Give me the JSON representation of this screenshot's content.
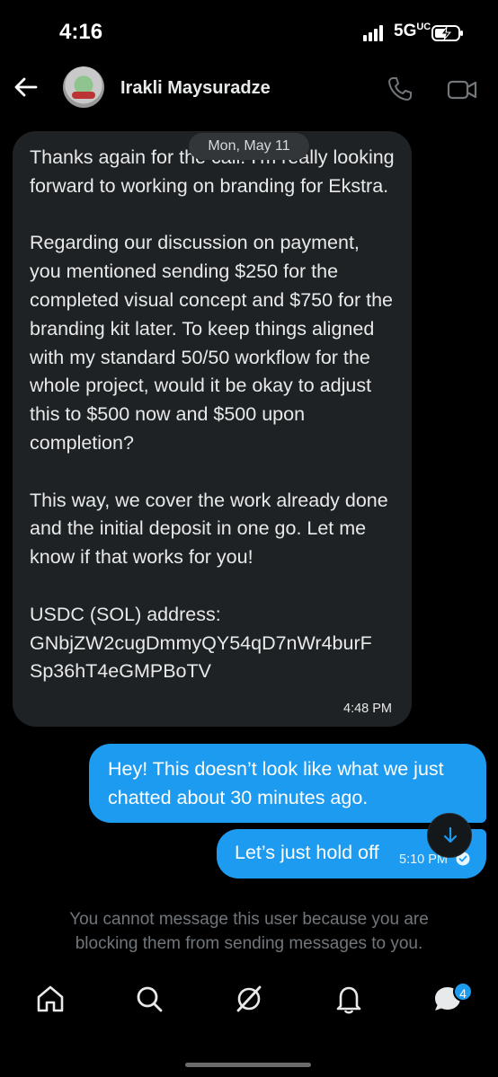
{
  "status_bar": {
    "time": "4:16",
    "network": "5G",
    "network_suffix": "UC"
  },
  "header": {
    "contact_name": "Irakli Maysuradze",
    "icons": [
      "back-arrow-icon",
      "avatar",
      "phone-icon",
      "video-icon"
    ]
  },
  "conversation": {
    "date_separator": "Mon, May 11",
    "received": {
      "text": "Thanks again for the call! I'm really looking forward to working on branding for Ekstra.\n\nRegarding our discussion on payment, you mentioned sending $250 for the completed visual concept and $750 for the branding kit later. To keep things aligned with my standard 50/50 workflow for the whole project, would it be okay to adjust this to $500 now and $500 upon completion?\n\nThis way, we cover the work already done and the initial deposit in one go. Let me know if that works for you!\n\nUSDC (SOL) address:\nGNbjZW2cugDmmyQY54qD7nWr4burF\nSp36hT4eGMPBoTV",
      "time": "4:48 PM"
    },
    "sent": [
      {
        "text": "Hey! This doesn’t look like what we just chatted about 30 minutes ago."
      },
      {
        "text": "Let’s just hold off",
        "time": "5:10 PM"
      }
    ],
    "blocked_notice": "You cannot message this user because you are blocking them from sending messages to you."
  },
  "bottom_nav": {
    "items": [
      "home-icon",
      "search-icon",
      "grok-icon",
      "notifications-icon",
      "messages-icon"
    ],
    "messages_badge": "4"
  },
  "colors": {
    "accent": "#1d9bf0",
    "bubble_received": "#1f2224",
    "background": "#000000",
    "muted_text": "#71767b"
  }
}
